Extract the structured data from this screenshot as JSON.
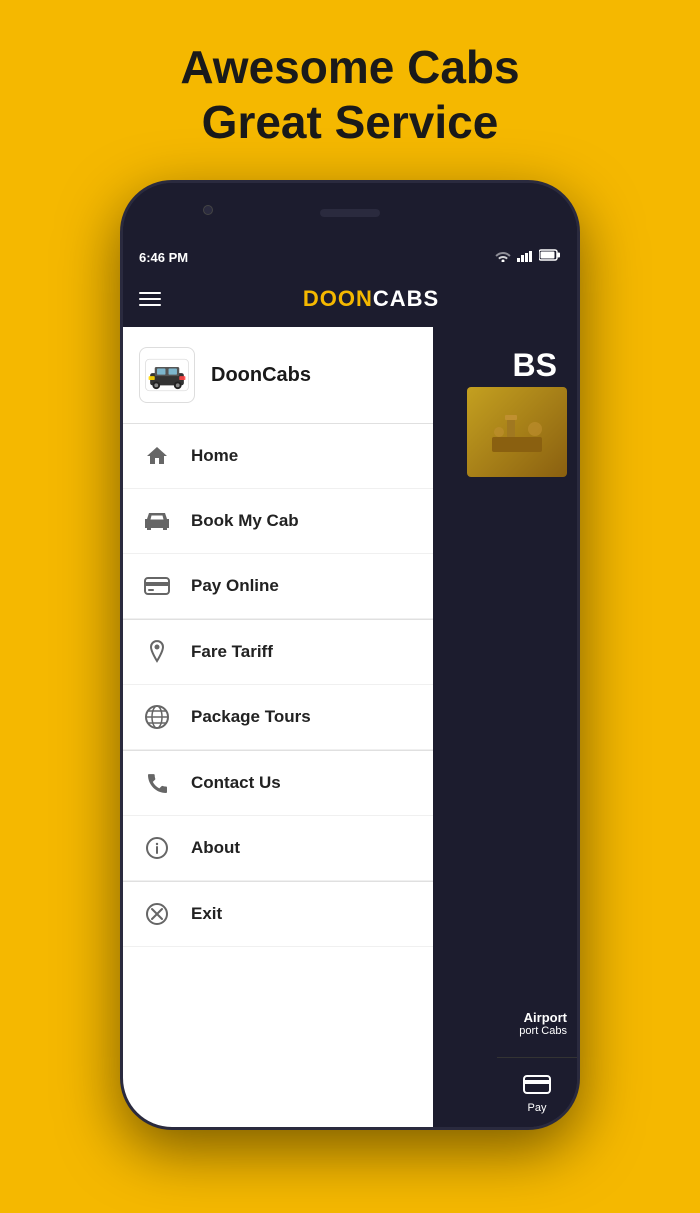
{
  "page": {
    "background_color": "#F5B800",
    "headline_line1": "Awesome Cabs",
    "headline_line2": "Great Service"
  },
  "status_bar": {
    "time": "6:46 PM",
    "wifi": "WiFi",
    "signal": "Signal",
    "battery": "Battery"
  },
  "app_bar": {
    "title_part1": "DOON",
    "title_part2": "CABS",
    "menu_icon": "hamburger-icon"
  },
  "drawer": {
    "brand_name": "DoonCabs",
    "menu_items": [
      {
        "id": "home",
        "label": "Home",
        "icon": "home-icon"
      },
      {
        "id": "book-my-cab",
        "label": "Book My Cab",
        "icon": "cab-icon"
      },
      {
        "id": "pay-online",
        "label": "Pay Online",
        "icon": "pay-icon"
      },
      {
        "id": "fare-tariff",
        "label": "Fare Tariff",
        "icon": "location-icon"
      },
      {
        "id": "package-tours",
        "label": "Package Tours",
        "icon": "globe-icon"
      },
      {
        "id": "contact-us",
        "label": "Contact Us",
        "icon": "phone-icon"
      },
      {
        "id": "about",
        "label": "About",
        "icon": "info-icon"
      },
      {
        "id": "exit",
        "label": "Exit",
        "icon": "exit-icon"
      }
    ]
  },
  "bottom_nav": {
    "pay_label": "Pay"
  }
}
